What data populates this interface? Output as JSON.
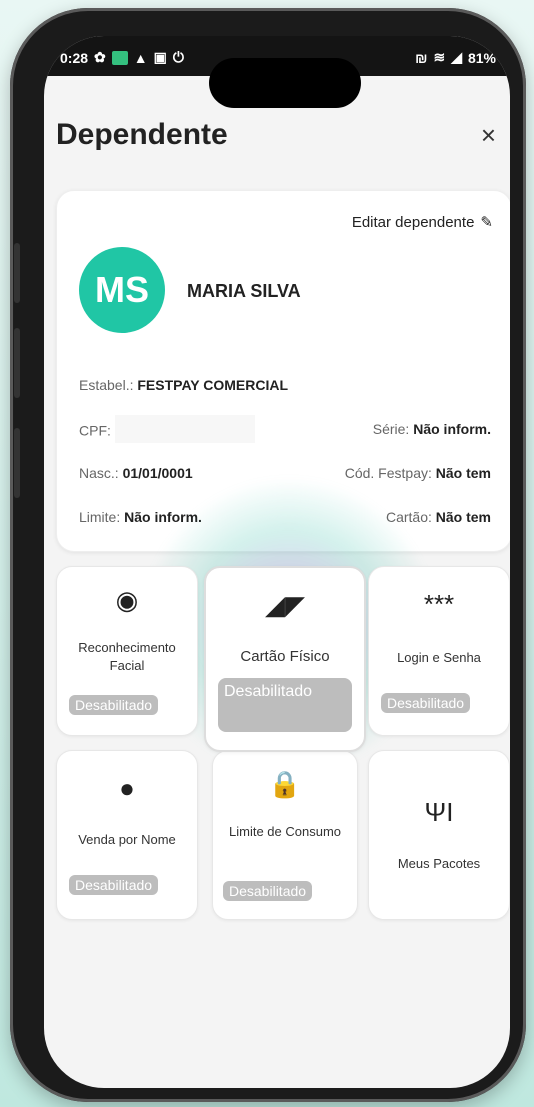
{
  "status": {
    "time": "0:28",
    "battery": "81%"
  },
  "header": {
    "title": "Dependente",
    "close": "×"
  },
  "card": {
    "edit_label": "Editar dependente",
    "avatar_initials": "MS",
    "name": "MARIA SILVA",
    "estabel_label": "Estabel.:",
    "estabel_value": "FESTPAY COMERCIAL",
    "cpf_label": "CPF:",
    "serie_label": "Série:",
    "serie_value": "Não inform.",
    "nasc_label": "Nasc.:",
    "nasc_value": "01/01/0001",
    "cod_label": "Cód. Festpay:",
    "cod_value": "Não tem",
    "limite_label": "Limite:",
    "limite_value": "Não inform.",
    "cartao_label": "Cartão:",
    "cartao_value": "Não tem"
  },
  "tiles": [
    {
      "label": "Reconhecimento Facial",
      "badge": "Desabilitado"
    },
    {
      "label": "Cartão Físico",
      "badge": "Desabilitado"
    },
    {
      "label": "Login e Senha",
      "badge": "Desabilitado"
    },
    {
      "label": "Venda por Nome",
      "badge": "Desabilitado"
    },
    {
      "label": "Limite de Consumo",
      "badge": "Desabilitado"
    },
    {
      "label": "Meus Pacotes",
      "badge": ""
    }
  ],
  "colors": {
    "accent": "#20c6a5",
    "badge": "#bdbdbd"
  }
}
